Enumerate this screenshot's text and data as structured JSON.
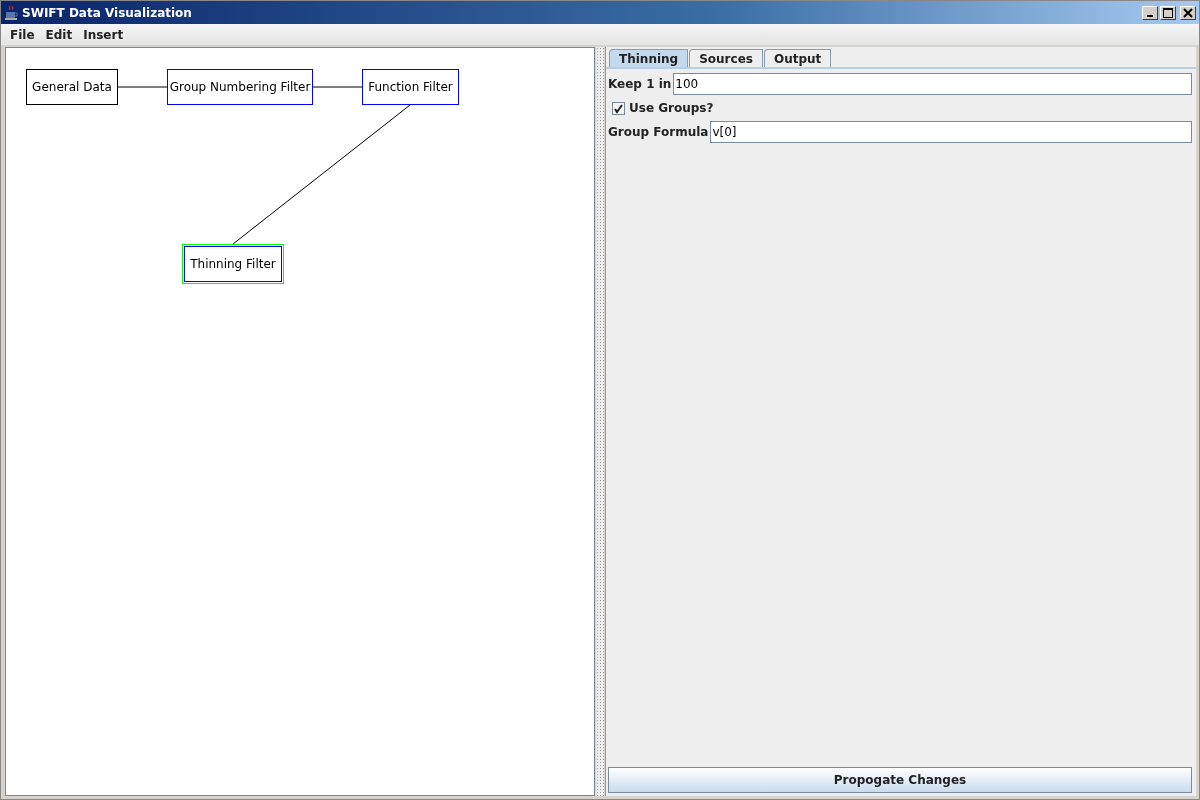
{
  "window": {
    "title": "SWIFT Data Visualization"
  },
  "menu": [
    "File",
    "Edit",
    "Insert"
  ],
  "diagram": {
    "nodes": [
      {
        "label": "General Data",
        "kind": "source",
        "selected": false
      },
      {
        "label": "Group Numbering Filter",
        "kind": "filter",
        "selected": false
      },
      {
        "label": "Function Filter",
        "kind": "filter",
        "selected": false
      },
      {
        "label": "Thinning Filter",
        "kind": "filter",
        "selected": true
      }
    ]
  },
  "tabs": [
    {
      "label": "Thinning",
      "selected": true
    },
    {
      "label": "Sources",
      "selected": false
    },
    {
      "label": "Output",
      "selected": false
    }
  ],
  "form": {
    "keep_label": "Keep 1 in",
    "keep_value": "100",
    "use_groups": {
      "label": "Use Groups?",
      "checked": true
    },
    "formula_label": "Group Formula",
    "formula_value": "v[0]"
  },
  "button": "Propogate Changes"
}
